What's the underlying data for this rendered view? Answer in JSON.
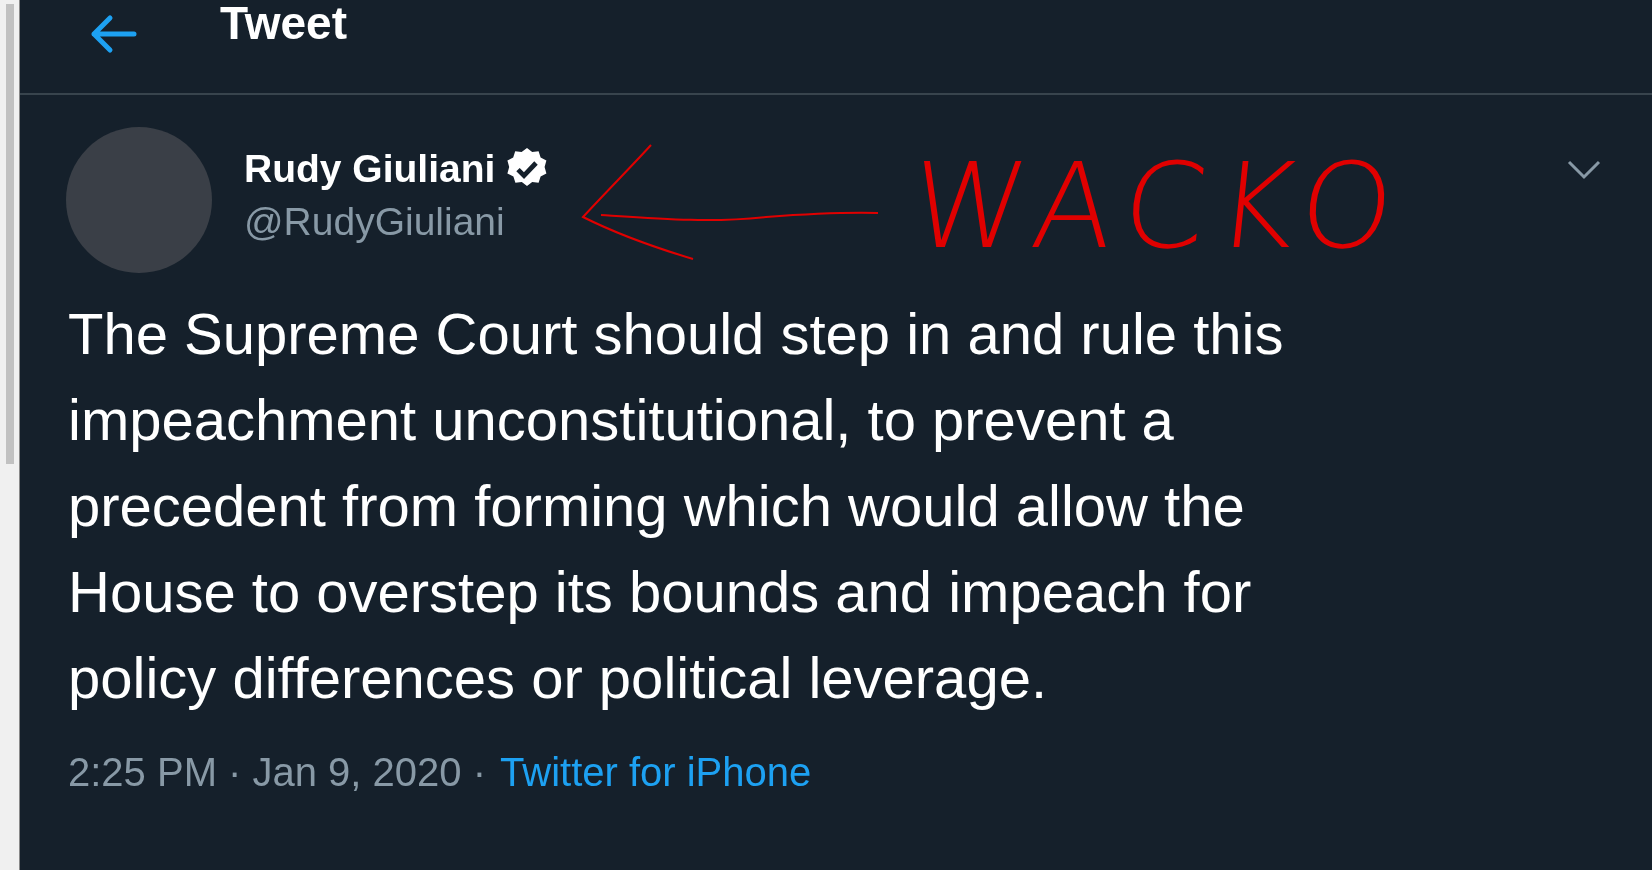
{
  "header": {
    "title": "Tweet"
  },
  "author": {
    "name": "Rudy Giuliani",
    "handle": "@RudyGiuliani",
    "verified": true
  },
  "annotation": {
    "text": "WACKO"
  },
  "tweet": {
    "text": "The Supreme Court should step in and rule this impeachment unconstitutional, to prevent a precedent from forming which would allow the House to overstep its bounds and impeach for policy differences or political leverage."
  },
  "meta": {
    "timestamp": "2:25 PM · Jan 9, 2020 ·",
    "source": "Twitter for iPhone"
  }
}
